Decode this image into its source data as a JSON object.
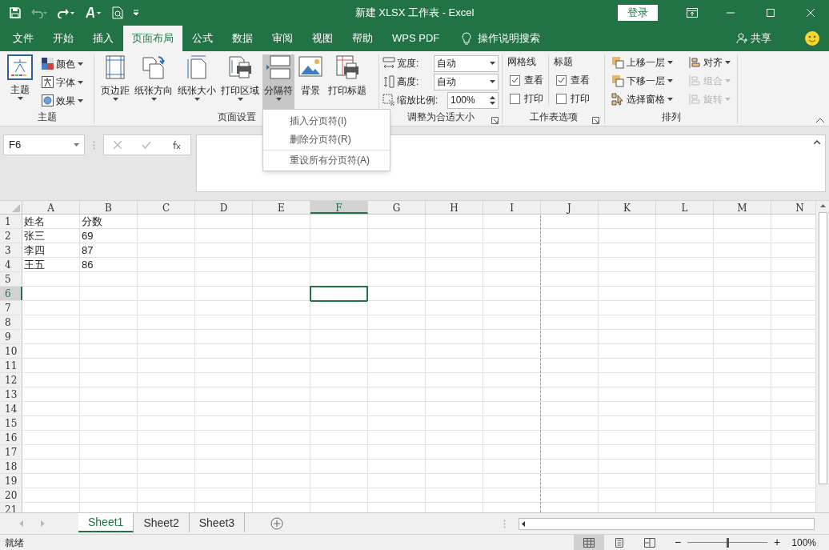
{
  "window": {
    "title": "新建 XLSX 工作表  -  Excel",
    "sign_in": "登录"
  },
  "tabs": [
    {
      "label": "文件",
      "selected": false
    },
    {
      "label": "开始",
      "selected": false
    },
    {
      "label": "插入",
      "selected": false
    },
    {
      "label": "页面布局",
      "selected": true
    },
    {
      "label": "公式",
      "selected": false
    },
    {
      "label": "数据",
      "selected": false
    },
    {
      "label": "审阅",
      "selected": false
    },
    {
      "label": "视图",
      "selected": false
    },
    {
      "label": "帮助",
      "selected": false
    },
    {
      "label": "WPS PDF",
      "selected": false
    }
  ],
  "tell_me": "操作说明搜索",
  "share": "共享",
  "theme_group": {
    "label": "主题",
    "big_button": "主题",
    "small_buttons": [
      "颜色",
      "字体",
      "效果"
    ]
  },
  "page_setup_group": {
    "label": "页面设置",
    "buttons": [
      {
        "label": "页边距",
        "selected": false
      },
      {
        "label": "纸张方向",
        "selected": false
      },
      {
        "label": "纸张大小",
        "selected": false
      },
      {
        "label": "打印区域",
        "selected": false
      },
      {
        "label": "分隔符",
        "selected": true
      },
      {
        "label": "背景",
        "selected": false
      },
      {
        "label": "打印标题",
        "selected": false
      }
    ]
  },
  "scale_group": {
    "label": "调整为合适大小",
    "fields": [
      {
        "label": "宽度:",
        "value": "自动",
        "kind": "dropdown"
      },
      {
        "label": "高度:",
        "value": "自动",
        "kind": "dropdown"
      },
      {
        "label": "缩放比例:",
        "value": "100%",
        "kind": "spinner"
      }
    ]
  },
  "sheet_options_group": {
    "label": "工作表选项",
    "columns": [
      {
        "title": "网格线",
        "options": [
          {
            "label": "查看",
            "checked": true
          },
          {
            "label": "打印",
            "checked": false
          }
        ]
      },
      {
        "title": "标题",
        "options": [
          {
            "label": "查看",
            "checked": true
          },
          {
            "label": "打印",
            "checked": false
          }
        ]
      }
    ]
  },
  "arrange_group": {
    "label": "排列",
    "buttons": [
      {
        "label": "上移一层",
        "disabled": false
      },
      {
        "label": "对齐",
        "disabled": false
      },
      {
        "label": "下移一层",
        "disabled": false
      },
      {
        "label": "组合",
        "disabled": true
      },
      {
        "label": "选择窗格",
        "disabled": false
      },
      {
        "label": "旋转",
        "disabled": true
      }
    ]
  },
  "dropdown_menu": {
    "items": [
      "插入分页符(I)",
      "删除分页符(R)",
      "重设所有分页符(A)"
    ]
  },
  "name_box": "F6",
  "columns": [
    {
      "label": "A",
      "selected": false,
      "page_break": false
    },
    {
      "label": "B",
      "selected": false,
      "page_break": false
    },
    {
      "label": "C",
      "selected": false,
      "page_break": false
    },
    {
      "label": "D",
      "selected": false,
      "page_break": false
    },
    {
      "label": "E",
      "selected": false,
      "page_break": false
    },
    {
      "label": "F",
      "selected": true,
      "page_break": false
    },
    {
      "label": "G",
      "selected": false,
      "page_break": false
    },
    {
      "label": "H",
      "selected": false,
      "page_break": false
    },
    {
      "label": "I",
      "selected": false,
      "page_break": true
    },
    {
      "label": "J",
      "selected": false,
      "page_break": false
    },
    {
      "label": "K",
      "selected": false,
      "page_break": false
    },
    {
      "label": "L",
      "selected": false,
      "page_break": false
    },
    {
      "label": "M",
      "selected": false,
      "page_break": false
    },
    {
      "label": "N",
      "selected": false,
      "page_break": false
    }
  ],
  "rows": [
    {
      "number": "1",
      "selected": false,
      "cells": [
        "姓名",
        "分数"
      ]
    },
    {
      "number": "2",
      "selected": false,
      "cells": [
        "张三",
        "69"
      ]
    },
    {
      "number": "3",
      "selected": false,
      "cells": [
        "李四",
        "87"
      ]
    },
    {
      "number": "4",
      "selected": false,
      "cells": [
        "王五",
        "86"
      ]
    },
    {
      "number": "5",
      "selected": false
    },
    {
      "number": "6",
      "selected": true
    },
    {
      "number": "7",
      "selected": false
    },
    {
      "number": "8",
      "selected": false
    },
    {
      "number": "9",
      "selected": false
    },
    {
      "number": "10",
      "selected": false
    },
    {
      "number": "11",
      "selected": false
    },
    {
      "number": "12",
      "selected": false
    },
    {
      "number": "13",
      "selected": false
    },
    {
      "number": "14",
      "selected": false
    },
    {
      "number": "15",
      "selected": false
    },
    {
      "number": "16",
      "selected": false
    },
    {
      "number": "17",
      "selected": false
    },
    {
      "number": "18",
      "selected": false
    },
    {
      "number": "19",
      "selected": false
    },
    {
      "number": "20",
      "selected": false
    },
    {
      "number": "21",
      "selected": false
    }
  ],
  "sheet_tabs": [
    {
      "label": "Sheet1",
      "selected": true
    },
    {
      "label": "Sheet2",
      "selected": false
    },
    {
      "label": "Sheet3",
      "selected": false
    }
  ],
  "status_bar": {
    "status": "就绪",
    "view_modes": [
      {
        "kind": "normal",
        "selected": true
      },
      {
        "kind": "page_layout",
        "selected": false
      },
      {
        "kind": "page_break",
        "selected": false
      }
    ],
    "zoom_out": "−",
    "zoom_slider": {
      "level": 0.5
    },
    "zoom_in": "+",
    "zoom": "100%"
  }
}
